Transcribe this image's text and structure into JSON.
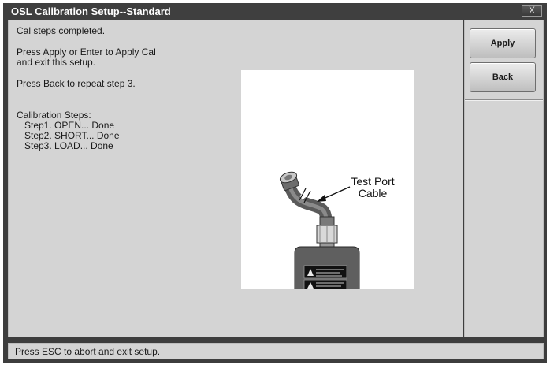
{
  "window": {
    "title": "OSL Calibration Setup--Standard",
    "close_label": "X"
  },
  "messages": {
    "line1": "Cal steps completed.",
    "line2a": "Press Apply or Enter to Apply Cal",
    "line2b": "and exit this setup.",
    "line3": "Press Back to repeat step 3.",
    "steps_heading": "Calibration Steps:",
    "steps": [
      "Step1. OPEN... Done",
      "Step2. SHORT... Done",
      "Step3. LOAD... Done"
    ]
  },
  "figure": {
    "label_line1": "Test Port",
    "label_line2": "Cable"
  },
  "buttons": {
    "apply": "Apply",
    "back": "Back"
  },
  "status": {
    "text": "Press ESC to abort and exit setup."
  }
}
